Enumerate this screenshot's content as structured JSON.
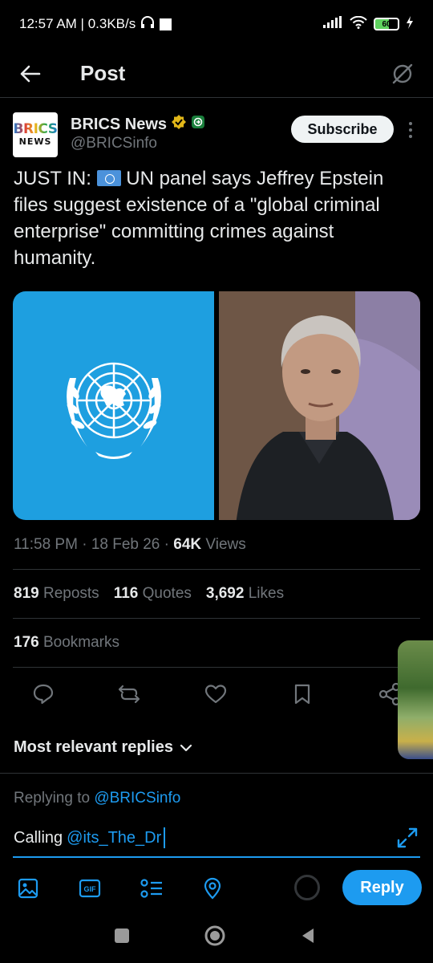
{
  "status_bar": {
    "time_speed": "12:57 AM | 0.3KB/s",
    "battery": "60"
  },
  "header": {
    "title": "Post"
  },
  "author": {
    "avatar_text_top": "BRICS",
    "avatar_text_bottom": "NEWS",
    "name": "BRICS News",
    "handle": "@BRICSinfo",
    "subscribe_label": "Subscribe"
  },
  "tweet": {
    "prefix": "JUST IN:",
    "text": "UN panel says Jeffrey Epstein files suggest existence of a \"global criminal enterprise\" committing crimes against humanity."
  },
  "meta": {
    "time": "11:58 PM",
    "date": "18 Feb 26",
    "views_count": "64K",
    "views_label": "Views"
  },
  "stats": {
    "reposts_count": "819",
    "reposts_label": "Reposts",
    "quotes_count": "116",
    "quotes_label": "Quotes",
    "likes_count": "3,692",
    "likes_label": "Likes",
    "bookmarks_count": "176",
    "bookmarks_label": "Bookmarks"
  },
  "replies_sort": {
    "label": "Most relevant replies"
  },
  "composer": {
    "replying_to_label": "Replying to",
    "replying_to_handle": "@BRICSinfo",
    "input_text": "Calling",
    "input_mention": "@its_The_Dr",
    "reply_label": "Reply",
    "gif_label": "GIF"
  },
  "colors": {
    "accent": "#1d9bf0",
    "background": "#000000",
    "secondary_text": "#71767b",
    "verified_gold": "#e2b719",
    "un_blue": "#1e9fe0"
  }
}
